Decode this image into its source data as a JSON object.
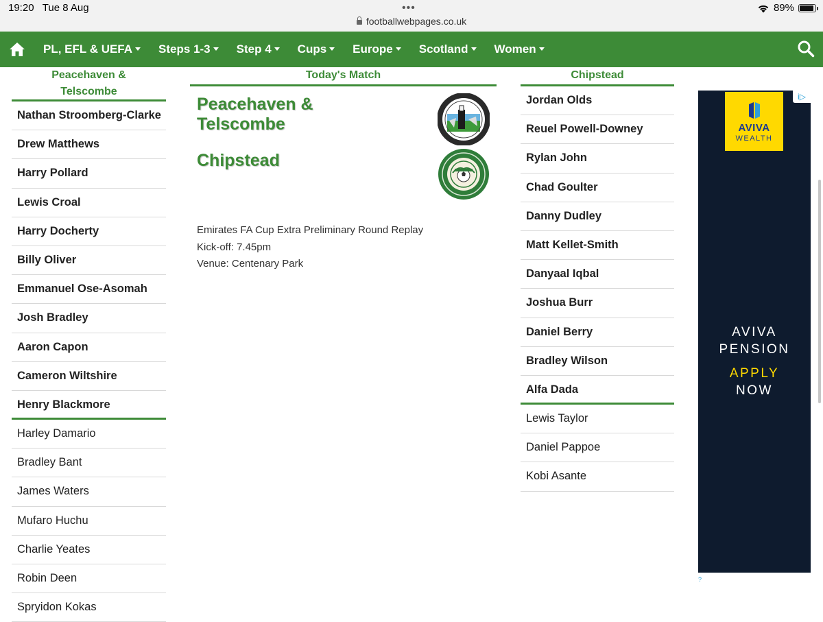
{
  "status_bar": {
    "time": "19:20",
    "date": "Tue 8 Aug",
    "url": "footballwebpages.co.uk",
    "battery": "89%",
    "battery_level": 0.89
  },
  "nav": {
    "items": [
      {
        "label": "PL, EFL & UEFA"
      },
      {
        "label": "Steps 1-3"
      },
      {
        "label": "Step 4"
      },
      {
        "label": "Cups"
      },
      {
        "label": "Europe"
      },
      {
        "label": "Scotland"
      },
      {
        "label": "Women"
      }
    ]
  },
  "home_team": {
    "heading": "Peacehaven & Telscombe",
    "players": [
      {
        "name": "Nathan Stroomberg-Clarke"
      },
      {
        "name": "Drew Matthews"
      },
      {
        "name": "Harry Pollard"
      },
      {
        "name": "Lewis Croal"
      },
      {
        "name": "Harry Docherty"
      },
      {
        "name": "Billy Oliver"
      },
      {
        "name": "Emmanuel Ose-Asomah"
      },
      {
        "name": "Josh Bradley"
      },
      {
        "name": "Aaron Capon"
      },
      {
        "name": "Cameron Wiltshire"
      },
      {
        "name": "Henry Blackmore"
      },
      {
        "name": "Harley Damario"
      },
      {
        "name": "Bradley Bant"
      },
      {
        "name": "James Waters"
      },
      {
        "name": "Mufaro Huchu"
      },
      {
        "name": "Charlie Yeates"
      },
      {
        "name": "Robin Deen"
      },
      {
        "name": "Spryidon Kokas"
      }
    ],
    "starters_count": 11
  },
  "match": {
    "heading": "Today's Match",
    "home_name": "Peacehaven & Telscombe",
    "away_name": "Chipstead",
    "competition": "Emirates FA Cup Extra Preliminary Round Replay",
    "kickoff": "Kick-off: 7.45pm",
    "venue": "Venue: Centenary Park"
  },
  "away_team": {
    "heading": "Chipstead",
    "players": [
      {
        "name": "Jordan Olds"
      },
      {
        "name": "Reuel Powell-Downey"
      },
      {
        "name": "Rylan John"
      },
      {
        "name": "Chad Goulter"
      },
      {
        "name": "Danny Dudley"
      },
      {
        "name": "Matt Kellet-Smith"
      },
      {
        "name": "Danyaal Iqbal"
      },
      {
        "name": "Joshua Burr"
      },
      {
        "name": "Daniel Berry"
      },
      {
        "name": "Bradley Wilson"
      },
      {
        "name": "Alfa Dada"
      },
      {
        "name": "Lewis Taylor"
      },
      {
        "name": "Daniel Pappoe"
      },
      {
        "name": "Kobi Asante"
      }
    ],
    "starters_count": 11
  },
  "ad": {
    "brand": "AVIVA",
    "brand_sub": "WEALTH",
    "headline_1": "AVIVA",
    "headline_2": "PENSION",
    "cta_1": "APPLY",
    "cta_2": "NOW",
    "tag": "i▷",
    "mark": "?"
  },
  "colors": {
    "brand_green": "#3d8b37",
    "ad_navy": "#0e1b2e",
    "ad_yellow": "#ffd900"
  }
}
